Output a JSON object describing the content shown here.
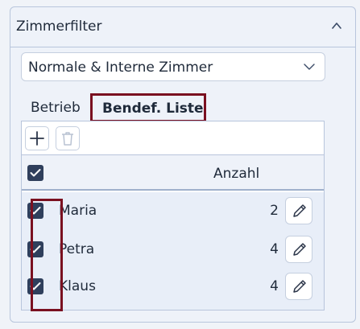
{
  "panel": {
    "title": "Zimmerfilter"
  },
  "filter_select": {
    "value": "Normale & Interne Zimmer"
  },
  "tabs": [
    {
      "label": "Betrieb"
    },
    {
      "label": "Bendef. Liste",
      "active": true
    }
  ],
  "toolbar": {
    "add_icon": "plus-icon",
    "delete_icon": "trash-icon"
  },
  "table": {
    "header": {
      "count_label": "Anzahl",
      "checked": true
    },
    "rows": [
      {
        "name": "Maria",
        "count": "2",
        "checked": true
      },
      {
        "name": "Petra",
        "count": "4",
        "checked": true
      },
      {
        "name": "Klaus",
        "count": "4",
        "checked": true
      }
    ]
  },
  "colors": {
    "highlight": "#7a1020",
    "checkbox": "#2f3f5c",
    "panel_bg": "#eef2f9"
  }
}
